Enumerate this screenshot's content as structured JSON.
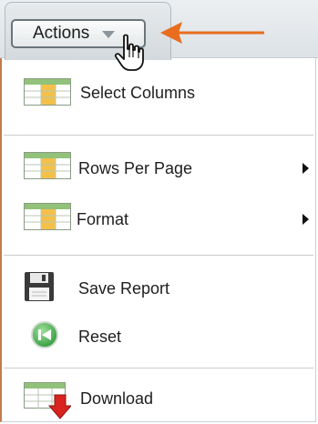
{
  "toolbar": {
    "actions_label": "Actions"
  },
  "menu": {
    "items": [
      {
        "label": "Select Columns",
        "icon": "table-icon",
        "submenu": false
      },
      {
        "label": "Rows Per Page",
        "icon": "table-icon",
        "submenu": true
      },
      {
        "label": "Format",
        "icon": "table-icon",
        "submenu": true
      },
      {
        "label": "Save Report",
        "icon": "floppy-disk-icon",
        "submenu": false
      },
      {
        "label": "Reset",
        "icon": "reset-icon",
        "submenu": false
      },
      {
        "label": "Download",
        "icon": "download-icon",
        "submenu": false
      }
    ]
  },
  "colors": {
    "arrow": "#e86d1f",
    "accent_border": "#c37b4e",
    "grid_green": "#92c27a",
    "grid_yellow": "#f4c04a",
    "reset_green": "#4caf50",
    "download_red": "#d8231e"
  }
}
